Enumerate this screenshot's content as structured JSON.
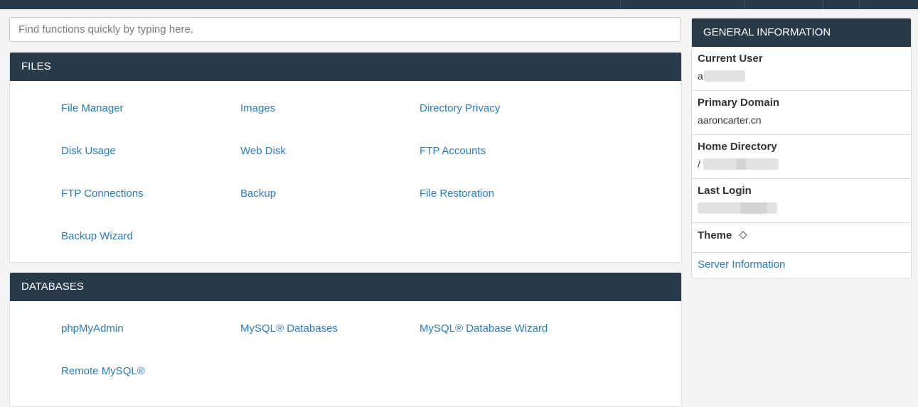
{
  "search": {
    "placeholder": "Find functions quickly by typing here."
  },
  "files": {
    "title": "FILES",
    "items": [
      {
        "label": "File Manager"
      },
      {
        "label": "Images"
      },
      {
        "label": "Directory Privacy"
      },
      {
        "label": "Disk Usage"
      },
      {
        "label": "Web Disk"
      },
      {
        "label": "FTP Accounts"
      },
      {
        "label": "FTP Connections"
      },
      {
        "label": "Backup"
      },
      {
        "label": "File Restoration"
      },
      {
        "label": "Backup Wizard"
      }
    ]
  },
  "databases": {
    "title": "DATABASES",
    "items": [
      {
        "label": "phpMyAdmin"
      },
      {
        "label": "MySQL® Databases"
      },
      {
        "label": "MySQL® Database Wizard"
      },
      {
        "label": "Remote MySQL®"
      }
    ]
  },
  "general_info": {
    "title": "GENERAL INFORMATION",
    "current_user_label": "Current User",
    "current_user_value": "a",
    "primary_domain_label": "Primary Domain",
    "primary_domain_value": "aaroncarter.cn",
    "home_directory_label": "Home Directory",
    "home_directory_value": "/",
    "last_login_label": "Last Login",
    "theme_label": "Theme",
    "server_info_link": "Server Information"
  },
  "colors": {
    "header_bg": "#293a4a",
    "link": "#2a7bbd"
  }
}
